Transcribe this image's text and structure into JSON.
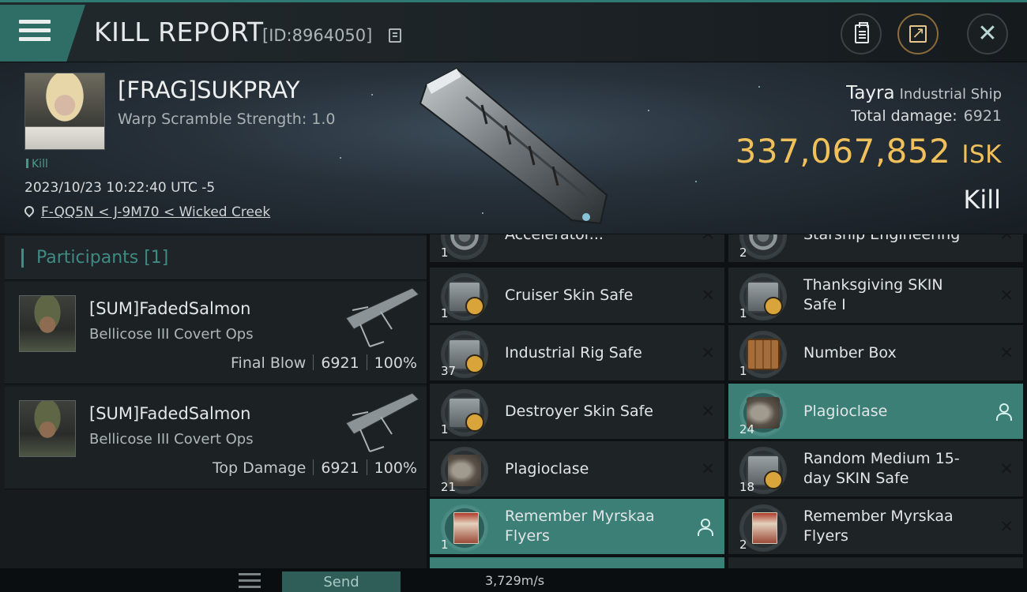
{
  "header": {
    "title": "KILL REPORT",
    "report_id": "[ID:8964050]"
  },
  "victim": {
    "name": "[FRAG]SUKPRAY",
    "warp_scramble": "Warp Scramble Strength: 1.0",
    "tag": "Kill",
    "timestamp": "2023/10/23 10:22:40 UTC -5",
    "location": "F-QQ5N < J-9M70 < Wicked Creek",
    "ship_name": "Tayra",
    "ship_class": "Industrial Ship",
    "total_damage_label": "Total damage:",
    "total_damage": "6921",
    "isk_value": "337,067,852",
    "isk_unit": "ISK",
    "result": "Kill"
  },
  "participants": {
    "title": "Participants [1]",
    "rows": [
      {
        "name": "[SUM]FadedSalmon",
        "ship": "Bellicose III Covert Ops",
        "label": "Final Blow",
        "damage": "6921",
        "percent": "100%"
      },
      {
        "name": "[SUM]FadedSalmon",
        "ship": "Bellicose III Covert Ops",
        "label": "Top Damage",
        "damage": "6921",
        "percent": "100%"
      }
    ]
  },
  "items": {
    "left": [
      {
        "qty": "1",
        "name": "Accelerator...",
        "icon": "accelerator-icon"
      },
      {
        "qty": "1",
        "name": "Cruiser Skin Safe",
        "icon": "skin-safe-icon"
      },
      {
        "qty": "37",
        "name": "Industrial Rig Safe",
        "icon": "rig-safe-icon"
      },
      {
        "qty": "1",
        "name": "Destroyer Skin Safe",
        "icon": "skin-safe-icon"
      },
      {
        "qty": "21",
        "name": "Plagioclase",
        "icon": "ore-icon"
      },
      {
        "qty": "1",
        "name": "Remember Myrskaa Flyers",
        "icon": "flyer-icon",
        "selected": true
      }
    ],
    "right": [
      {
        "qty": "2",
        "name": "Starship Engineering",
        "icon": "skillbook-icon"
      },
      {
        "qty": "1",
        "name": "Thanksgiving SKIN Safe I",
        "icon": "skin-safe-icon"
      },
      {
        "qty": "1",
        "name": "Number Box",
        "icon": "crate-icon"
      },
      {
        "qty": "24",
        "name": "Plagioclase",
        "icon": "ore-icon",
        "selected": true
      },
      {
        "qty": "18",
        "name": "Random Medium 15-day SKIN Safe",
        "icon": "skin-safe-icon"
      },
      {
        "qty": "2",
        "name": "Remember Myrskaa Flyers",
        "icon": "flyer-icon"
      }
    ]
  },
  "bottom": {
    "send_label": "Send",
    "speed": "3,729m/s"
  },
  "colors": {
    "accent": "#3b7f77",
    "isk": "#f0c05a",
    "participants_title": "#3f8b83"
  }
}
